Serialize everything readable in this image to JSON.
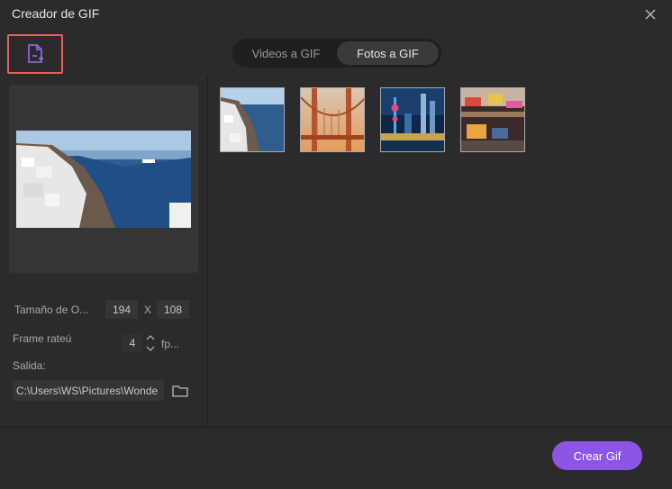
{
  "window": {
    "title": "Creador de GIF"
  },
  "tabs": [
    {
      "label": "Videos a GIF",
      "active": false
    },
    {
      "label": "Fotos a GIF",
      "active": true
    }
  ],
  "settings": {
    "size_label": "Tamaño de O...",
    "width": "194",
    "x_sep": "X",
    "height": "108",
    "frame_label": "Frame rateú",
    "frame_value": "4",
    "frame_unit": "fp...",
    "output_label": "Salida:",
    "output_path": "C:\\Users\\WS\\Pictures\\Wonde"
  },
  "thumbnails": [
    {
      "name": "thumb-santorini",
      "icon": "santorini-photo"
    },
    {
      "name": "thumb-golden-gate",
      "icon": "golden-gate-photo"
    },
    {
      "name": "thumb-shanghai-night",
      "icon": "shanghai-night-photo"
    },
    {
      "name": "thumb-hongkong-street",
      "icon": "hongkong-street-photo"
    }
  ],
  "actions": {
    "create_label": "Crear Gif"
  },
  "colors": {
    "accent": "#8c55e6",
    "highlight_border": "#e0635a",
    "background": "#2b2b2b"
  }
}
